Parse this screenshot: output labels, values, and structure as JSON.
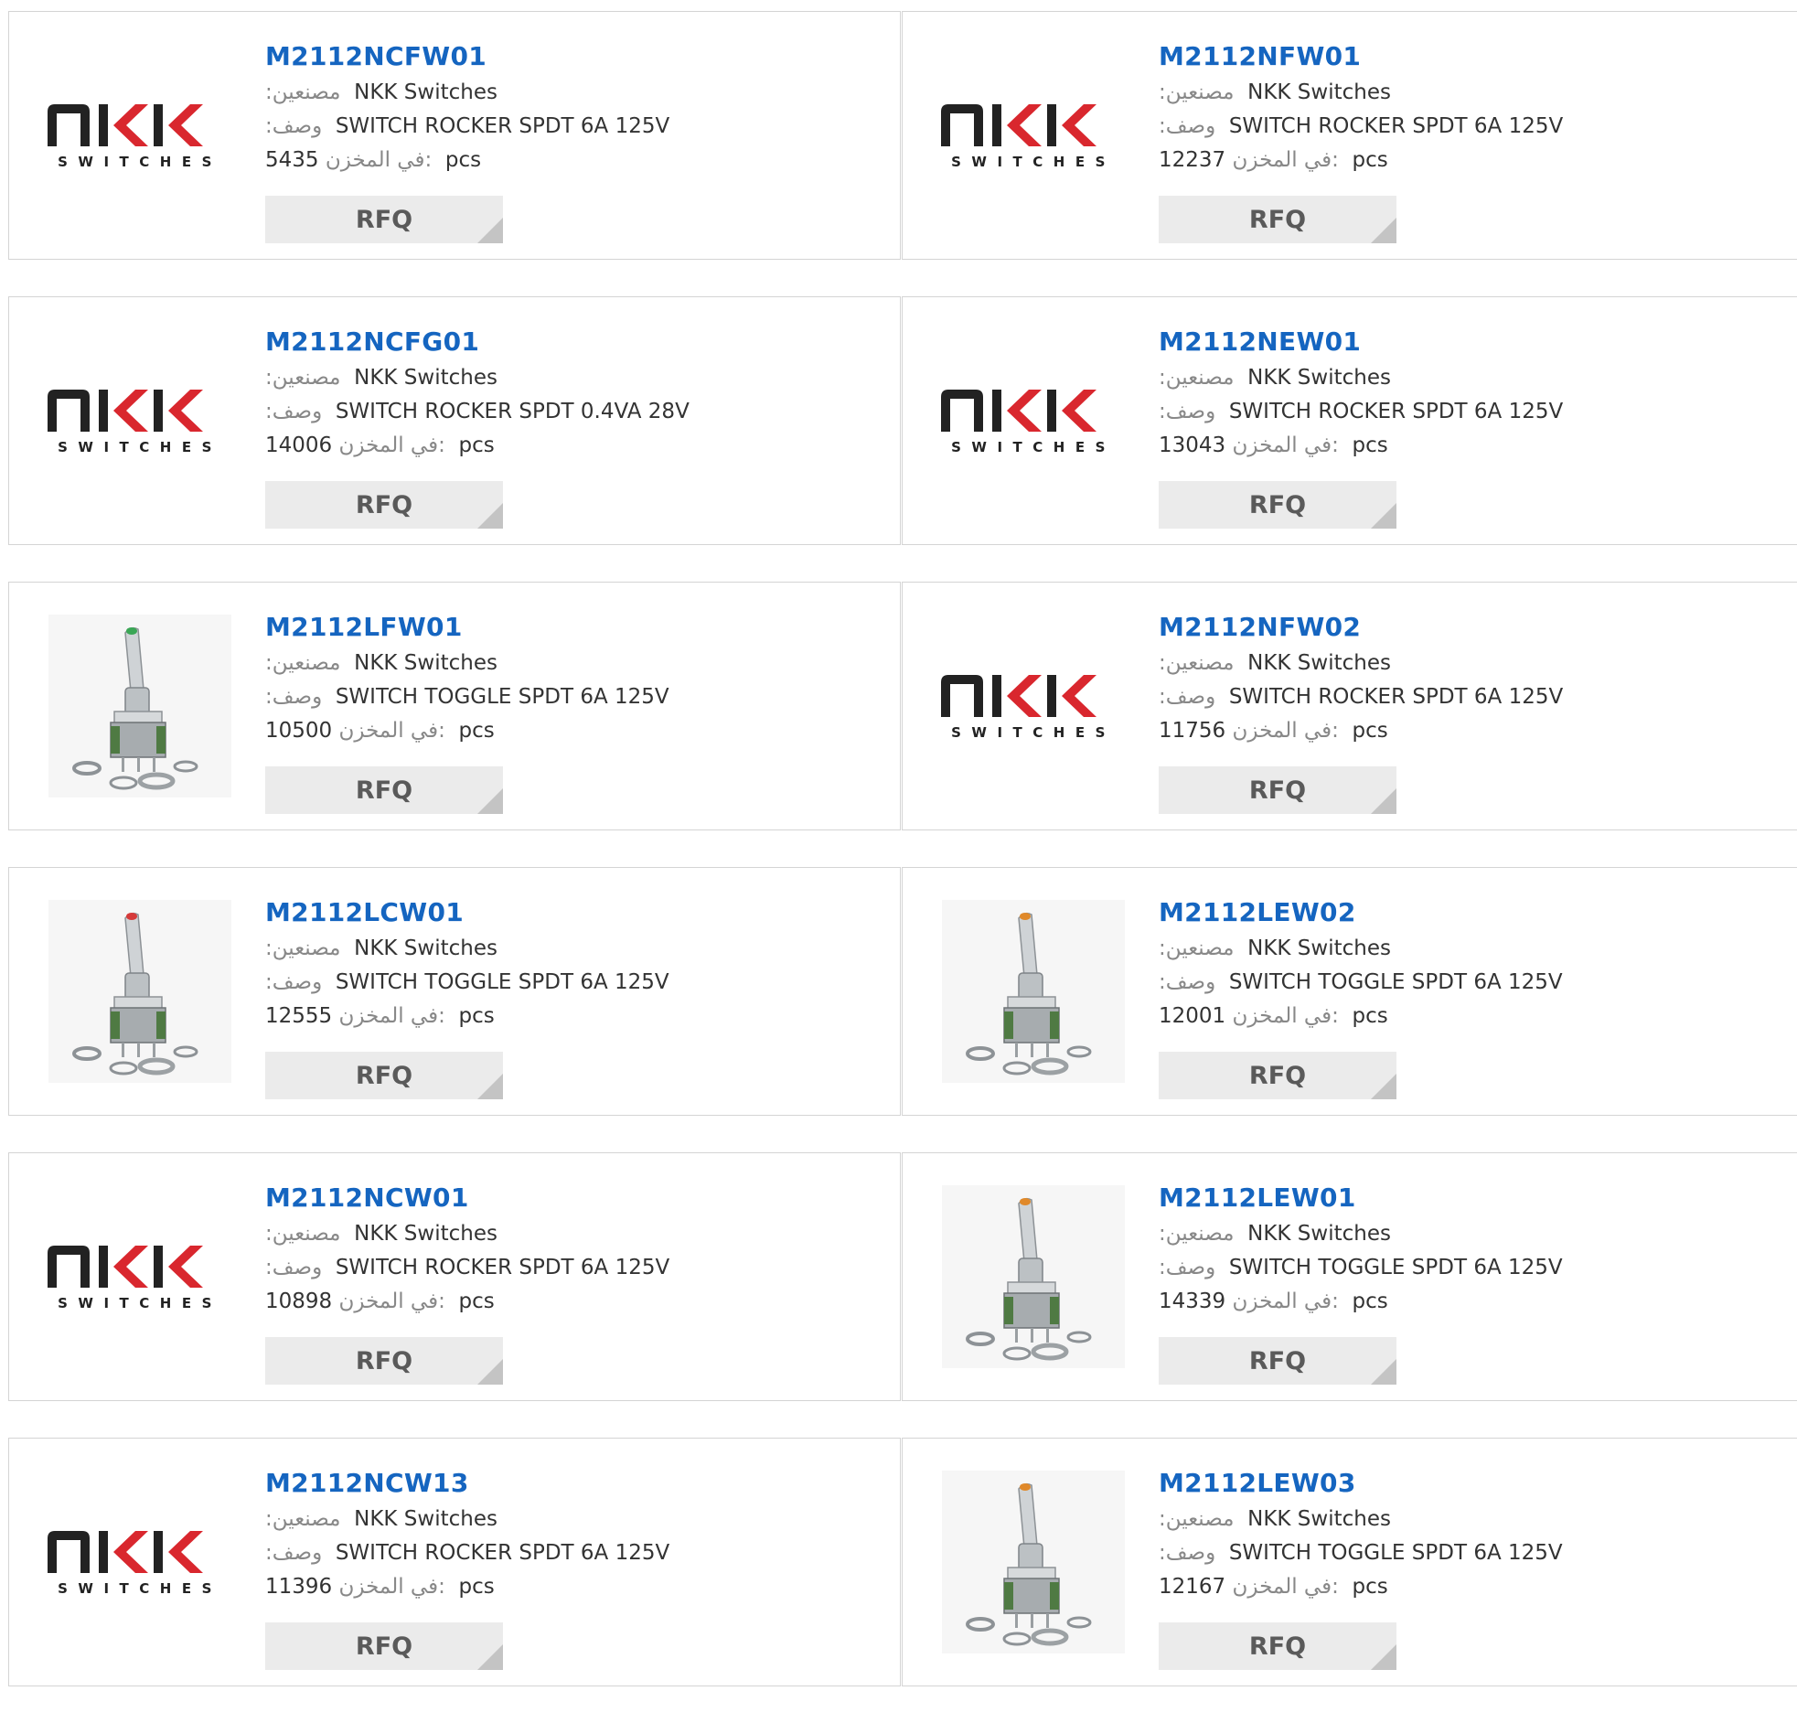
{
  "labels": {
    "manufacturer": ":مصنعين",
    "description": ":وصف",
    "stock": "في المخزن:",
    "unit": "pcs",
    "rfq": "RFQ"
  },
  "logo": {
    "brand": "NKK",
    "subtitle": "SWITCHES"
  },
  "products": [
    {
      "part": "M2112NCFW01",
      "manufacturer": "NKK Switches",
      "description": "SWITCH ROCKER SPDT 6A 125V",
      "stock": "5435",
      "image": "nkk-logo"
    },
    {
      "part": "M2112NFW01",
      "manufacturer": "NKK Switches",
      "description": "SWITCH ROCKER SPDT 6A 125V",
      "stock": "12237",
      "image": "nkk-logo"
    },
    {
      "part": "M2112NCFG01",
      "manufacturer": "NKK Switches",
      "description": "SWITCH ROCKER SPDT 0.4VA 28V",
      "stock": "14006",
      "image": "nkk-logo"
    },
    {
      "part": "M2112NEW01",
      "manufacturer": "NKK Switches",
      "description": "SWITCH ROCKER SPDT 6A 125V",
      "stock": "13043",
      "image": "nkk-logo"
    },
    {
      "part": "M2112LFW01",
      "manufacturer": "NKK Switches",
      "description": "SWITCH TOGGLE SPDT 6A 125V",
      "stock": "10500",
      "image": "toggle-photo",
      "tip_color": "#3aa655"
    },
    {
      "part": "M2112NFW02",
      "manufacturer": "NKK Switches",
      "description": "SWITCH ROCKER SPDT 6A 125V",
      "stock": "11756",
      "image": "nkk-logo"
    },
    {
      "part": "M2112LCW01",
      "manufacturer": "NKK Switches",
      "description": "SWITCH TOGGLE SPDT 6A 125V",
      "stock": "12555",
      "image": "toggle-photo",
      "tip_color": "#d63a3a"
    },
    {
      "part": "M2112LEW02",
      "manufacturer": "NKK Switches",
      "description": "SWITCH TOGGLE SPDT 6A 125V",
      "stock": "12001",
      "image": "toggle-photo",
      "tip_color": "#e0892a"
    },
    {
      "part": "M2112NCW01",
      "manufacturer": "NKK Switches",
      "description": "SWITCH ROCKER SPDT 6A 125V",
      "stock": "10898",
      "image": "nkk-logo"
    },
    {
      "part": "M2112LEW01",
      "manufacturer": "NKK Switches",
      "description": "SWITCH TOGGLE SPDT 6A 125V",
      "stock": "14339",
      "image": "toggle-photo",
      "tip_color": "#e0892a"
    },
    {
      "part": "M2112NCW13",
      "manufacturer": "NKK Switches",
      "description": "SWITCH ROCKER SPDT 6A 125V",
      "stock": "11396",
      "image": "nkk-logo"
    },
    {
      "part": "M2112LEW03",
      "manufacturer": "NKK Switches",
      "description": "SWITCH TOGGLE SPDT 6A 125V",
      "stock": "12167",
      "image": "toggle-photo",
      "tip_color": "#e0892a"
    }
  ],
  "colors": {
    "part_link": "#1565c0",
    "logo_red": "#d9272e",
    "logo_dark": "#222222",
    "rfq_bg": "#ebebeb",
    "border": "#d4d4d4"
  }
}
